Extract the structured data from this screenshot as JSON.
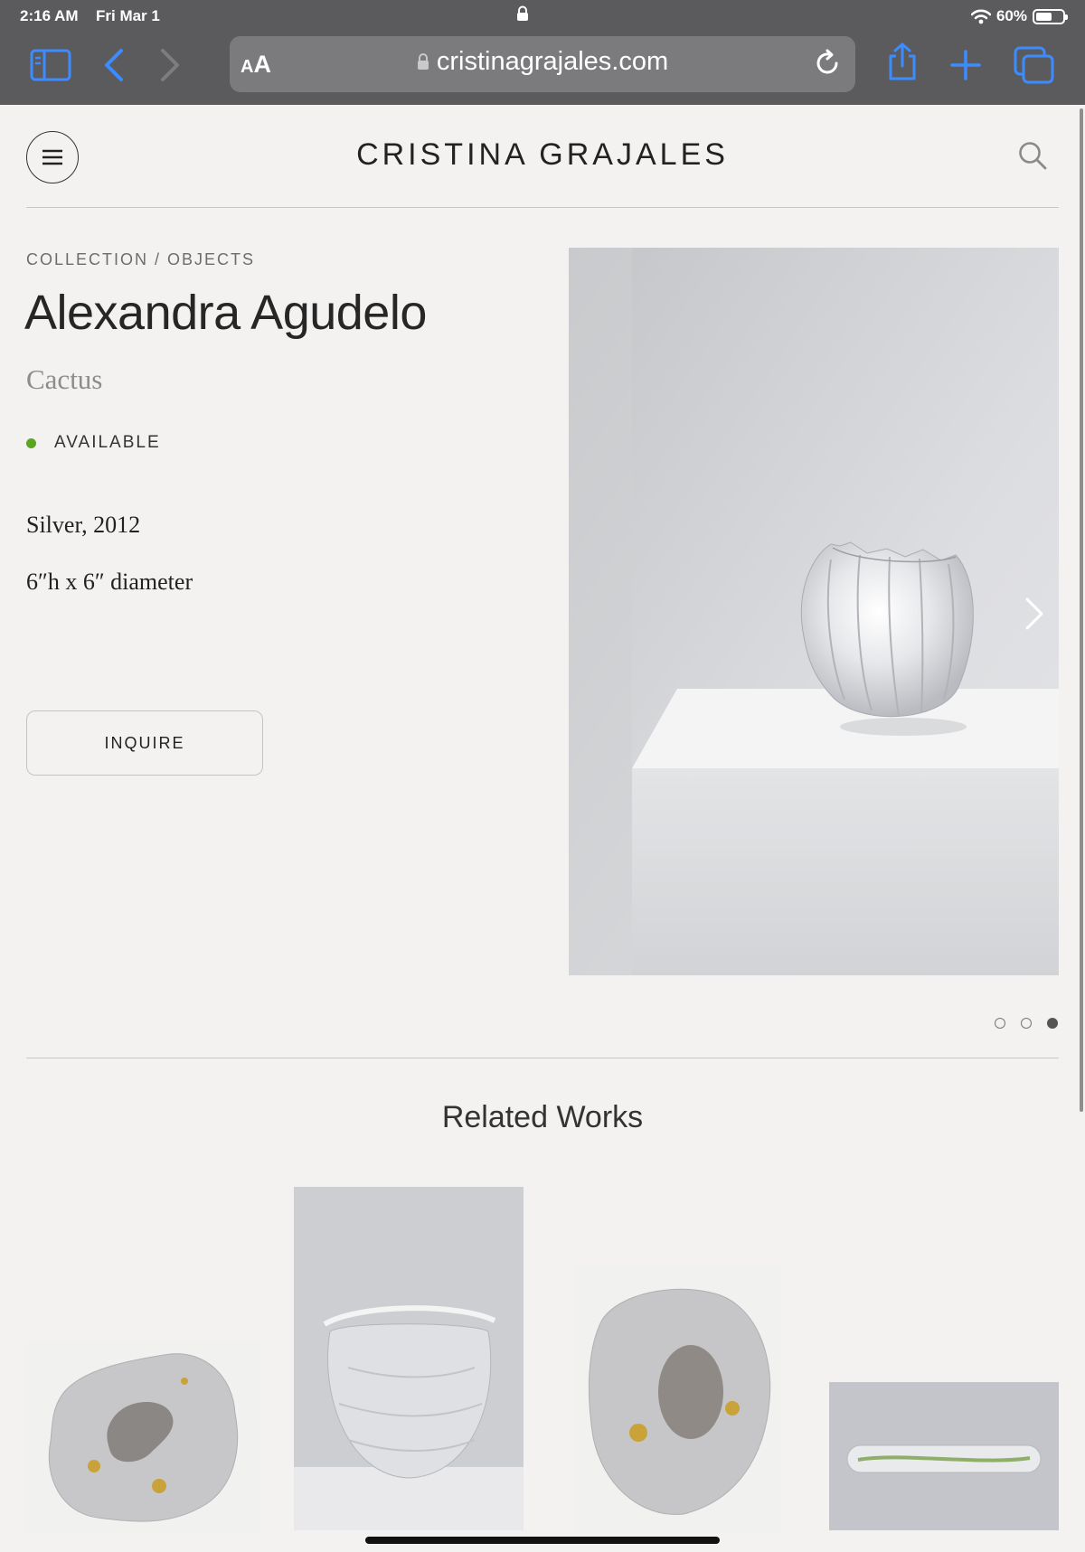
{
  "status_bar": {
    "time": "2:16 AM",
    "date": "Fri Mar 1",
    "battery": "60%",
    "battery_level": 0.6
  },
  "browser": {
    "reader_label_small": "A",
    "reader_label_large": "A",
    "url": "cristinagrajales.com"
  },
  "site": {
    "brand": "CRISTINA GRAJALES"
  },
  "product": {
    "breadcrumb": "COLLECTION / OBJECTS",
    "artist": "Alexandra Agudelo",
    "title": "Cactus",
    "availability": "AVAILABLE",
    "availability_color": "#5aa61e",
    "material_year": "Silver, 2012",
    "dimensions": "6″h x 6″ diameter",
    "inquire_label": "INQUIRE"
  },
  "carousel": {
    "slide_count": 3,
    "active_index": 3
  },
  "related": {
    "title": "Related Works"
  },
  "colors": {
    "chrome": "#5b5b5d",
    "accent_ios": "#3c8cff",
    "page_bg": "#f3f2f1"
  }
}
